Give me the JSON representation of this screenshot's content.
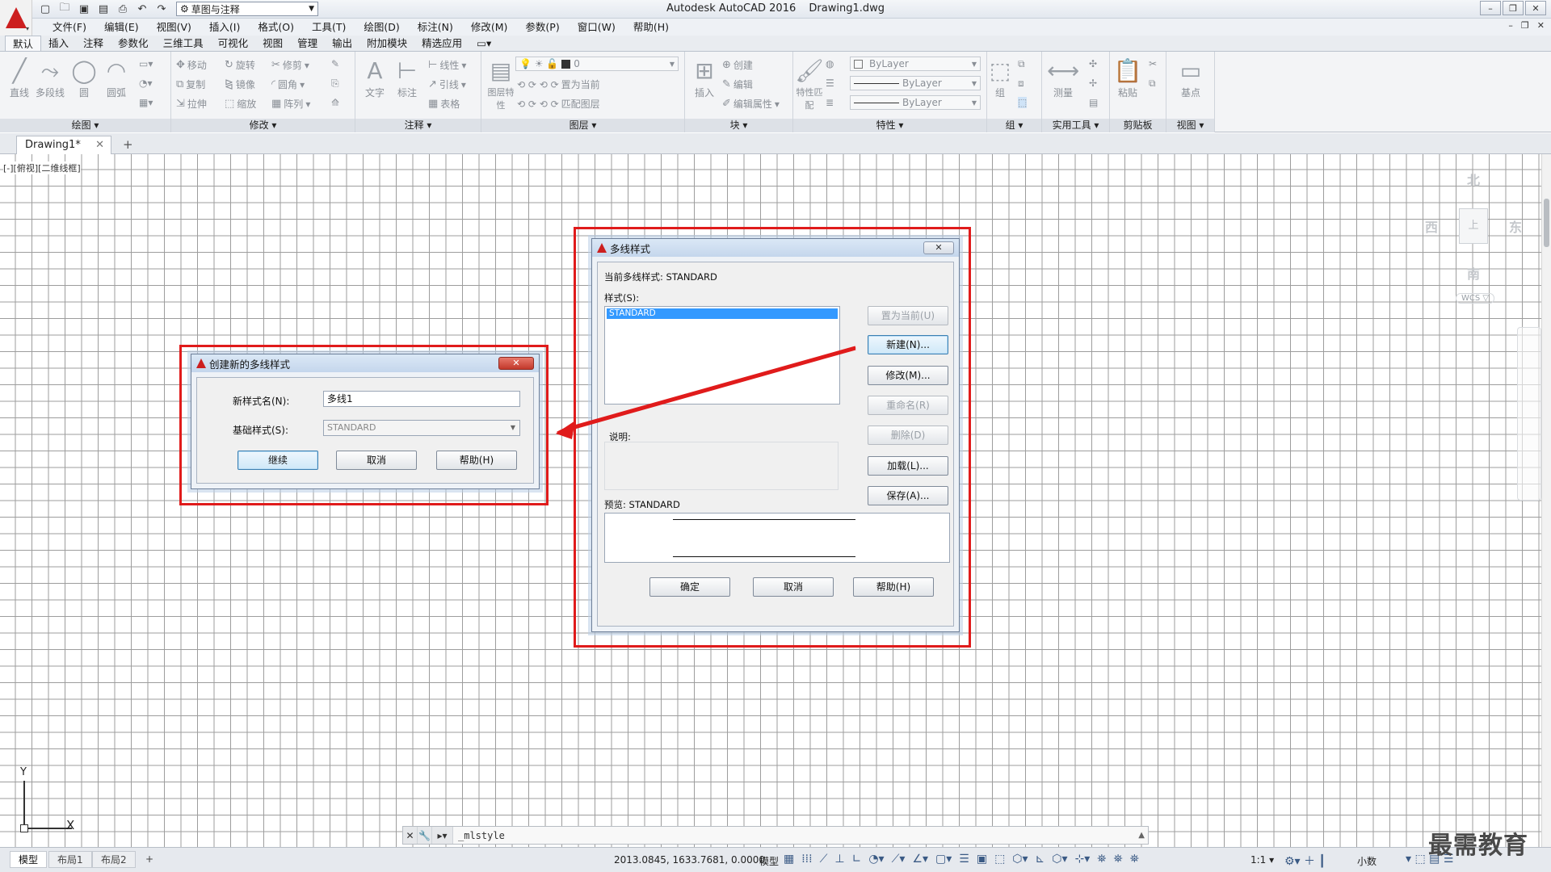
{
  "window": {
    "title_app": "Autodesk AutoCAD 2016",
    "title_file": "Drawing1.dwg",
    "workspace": "草图与注释",
    "controls": [
      "–",
      "❐",
      "✕"
    ]
  },
  "menu": [
    "文件(F)",
    "编辑(E)",
    "视图(V)",
    "插入(I)",
    "格式(O)",
    "工具(T)",
    "绘图(D)",
    "标注(N)",
    "修改(M)",
    "参数(P)",
    "窗口(W)",
    "帮助(H)"
  ],
  "ribbon_tabs": [
    "默认",
    "插入",
    "注释",
    "参数化",
    "三维工具",
    "可视化",
    "视图",
    "管理",
    "输出",
    "附加模块",
    "精选应用"
  ],
  "ribbon": {
    "draw": {
      "title": "绘图 ▾",
      "tools": [
        "直线",
        "多段线",
        "圆",
        "圆弧"
      ]
    },
    "modify": {
      "title": "修改 ▾",
      "tools": [
        "移动",
        "旋转",
        "修剪",
        "复制",
        "镜像",
        "圆角",
        "拉伸",
        "缩放",
        "阵列"
      ]
    },
    "annotation": {
      "title": "注释 ▾",
      "tools": [
        "文字",
        "标注",
        "线性",
        "引线",
        "表格"
      ]
    },
    "layers": {
      "title": "图层 ▾",
      "tools": [
        "图层特性",
        "置为当前",
        "匹配图层"
      ],
      "layer_value": "0"
    },
    "block": {
      "title": "块 ▾",
      "tools": [
        "插入",
        "创建",
        "编辑",
        "编辑属性"
      ]
    },
    "properties": {
      "title": "特性 ▾",
      "tools": [
        "特性匹配"
      ],
      "color": "ByLayer",
      "linetype": "ByLayer",
      "lineweight": "ByLayer"
    },
    "groups": {
      "title": "组 ▾",
      "tools": [
        "组"
      ]
    },
    "utilities": {
      "title": "实用工具 ▾",
      "tools": [
        "测量"
      ]
    },
    "clipboard": {
      "title": "剪贴板",
      "tools": [
        "粘贴"
      ]
    },
    "view": {
      "title": "视图 ▾",
      "tools": [
        "基点"
      ]
    }
  },
  "file_tab": {
    "name": "Drawing1*",
    "close": "✕",
    "new": "+"
  },
  "viewport_label": "[-][俯视][二维线框]",
  "viewcube": {
    "north": "北",
    "south": "南",
    "east": "东",
    "west": "西",
    "top": "上",
    "wcs": "WCS ▽"
  },
  "ucs": {
    "x": "X",
    "y": "Y"
  },
  "mlstyle_dialog": {
    "title": "多线样式",
    "close": "✕",
    "current_style_label": "当前多线样式: STANDARD",
    "styles_label": "样式(S):",
    "styles": [
      "STANDARD"
    ],
    "description_label": "说明:",
    "preview_label": "预览: STANDARD",
    "buttons": {
      "set_current": "置为当前(U)",
      "new": "新建(N)...",
      "modify": "修改(M)...",
      "rename": "重命名(R)",
      "delete": "删除(D)",
      "load": "加载(L)...",
      "save": "保存(A)...",
      "ok": "确定",
      "cancel": "取消",
      "help": "帮助(H)"
    }
  },
  "new_style_dialog": {
    "title": "创建新的多线样式",
    "close": "✕",
    "name_label": "新样式名(N):",
    "name_value": "多线1",
    "base_label": "基础样式(S):",
    "base_value": "STANDARD",
    "buttons": {
      "continue": "继续",
      "cancel": "取消",
      "help": "帮助(H)"
    }
  },
  "command_line": {
    "prompt": "_mlstyle"
  },
  "status": {
    "layout_tabs": [
      "模型",
      "布局1",
      "布局2"
    ],
    "add_tab": "+",
    "coords": "2013.0845, 1633.7681, 0.0000",
    "model": "模型",
    "scale": "1:1 ▾",
    "units": "小数"
  },
  "watermark": "最需教育",
  "colors": {
    "highlight": "#e01b1b",
    "selection": "#3399ff",
    "grid": "#9d9d9d"
  }
}
